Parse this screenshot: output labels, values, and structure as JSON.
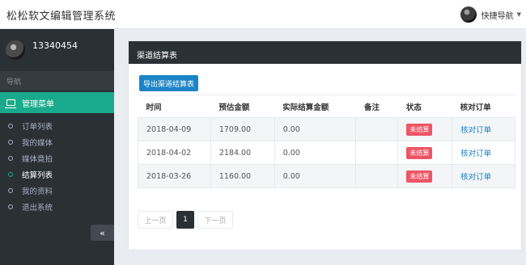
{
  "app": {
    "title": "松松软文编辑管理系统"
  },
  "quicknav": {
    "label": "快捷导航"
  },
  "user": {
    "name": "13340454"
  },
  "sidebar": {
    "nav_header": "导航",
    "menu_title": "管理菜单",
    "items": [
      {
        "label": "订单列表"
      },
      {
        "label": "我的媒体"
      },
      {
        "label": "媒体竟拍"
      },
      {
        "label": "结算列表"
      },
      {
        "label": "我的资料"
      },
      {
        "label": "退出系统"
      }
    ],
    "active_index": 3,
    "collapse_icon": "«"
  },
  "panel": {
    "title": "渠道结算表",
    "export_label": "导出渠道结算表"
  },
  "table": {
    "headers": [
      "时间",
      "预估金额",
      "实际结算金额",
      "备注",
      "状态",
      "核对订单"
    ],
    "rows": [
      {
        "date": "2018-04-09",
        "estimated": "1709.00",
        "actual": "0.00",
        "note": "",
        "status": "未结算",
        "action": "核对订单"
      },
      {
        "date": "2018-04-02",
        "estimated": "2184.00",
        "actual": "0.00",
        "note": "",
        "status": "未结算",
        "action": "核对订单"
      },
      {
        "date": "2018-03-26",
        "estimated": "1160.00",
        "actual": "0.00",
        "note": "",
        "status": "未结算",
        "action": "核对订单"
      }
    ]
  },
  "pager": {
    "prev": "上一页",
    "current": "1",
    "next": "下一页"
  },
  "colors": {
    "accent": "#19aa8d",
    "sidebar": "#2b3035",
    "primary": "#1c84c6",
    "danger": "#ed5565"
  }
}
